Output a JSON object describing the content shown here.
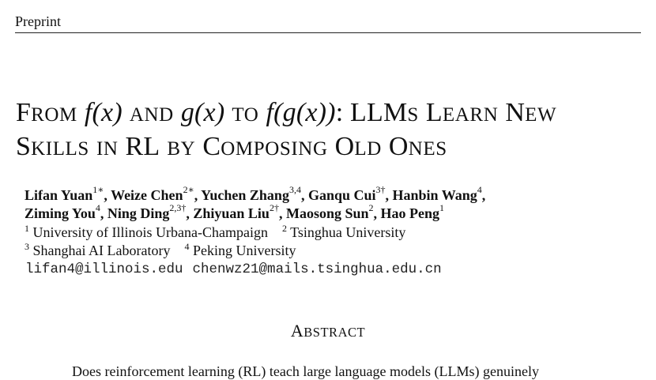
{
  "header": {
    "running_head": "Preprint"
  },
  "title": {
    "w1_cap": "F",
    "w1_sc": "ROM",
    "f_x": "f(x)",
    "w2_sc": "AND",
    "g_x": "g(x)",
    "w3_sc": "TO",
    "f_g_x": "f(g(x))",
    "colon_llm": ": LLM",
    "s_sc": "S",
    "l_cap": "L",
    "earn_sc": "EARN",
    "n_cap": "N",
    "ew_sc": "EW",
    "s2_cap": "S",
    "kills_sc": "KILLS",
    "in_sc": "IN",
    "rl": "RL",
    "by_sc": "BY",
    "c_cap": "C",
    "omposing_sc": "OMPOSING",
    "o_cap": "O",
    "ld_sc": "LD",
    "o2_cap": "O",
    "nes_sc": "NES"
  },
  "authors": [
    {
      "name": "Lifan Yuan",
      "sup": "1∗",
      "sep": ", "
    },
    {
      "name": "Weize Chen",
      "sup": "2∗",
      "sep": ", "
    },
    {
      "name": "Yuchen Zhang",
      "sup": "3,4",
      "sep": ", "
    },
    {
      "name": "Ganqu Cui",
      "sup": "3†",
      "sep": ", "
    },
    {
      "name": "Hanbin Wang",
      "sup": "4",
      "sep": ","
    },
    {
      "name": "Ziming You",
      "sup": "4",
      "sep": ", "
    },
    {
      "name": "Ning Ding",
      "sup": "2,3†",
      "sep": ", "
    },
    {
      "name": "Zhiyuan Liu",
      "sup": "2†",
      "sep": ", "
    },
    {
      "name": "Maosong Sun",
      "sup": "2",
      "sep": ", "
    },
    {
      "name": "Hao Peng",
      "sup": "1",
      "sep": ""
    }
  ],
  "affiliations": [
    {
      "sup": "1",
      "name": "University of Illinois Urbana-Champaign"
    },
    {
      "sup": "2",
      "name": "Tsinghua University"
    },
    {
      "sup": "3",
      "name": "Shanghai AI Laboratory"
    },
    {
      "sup": "4",
      "name": "Peking University"
    }
  ],
  "emails": [
    "lifan4@illinois.edu",
    "chenwz21@mails.tsinghua.edu.cn"
  ],
  "abstract": {
    "heading_cap": "A",
    "heading_sc": "BSTRACT",
    "first_line": "Does reinforcement learning (RL) teach large language models (LLMs) genuinely"
  }
}
